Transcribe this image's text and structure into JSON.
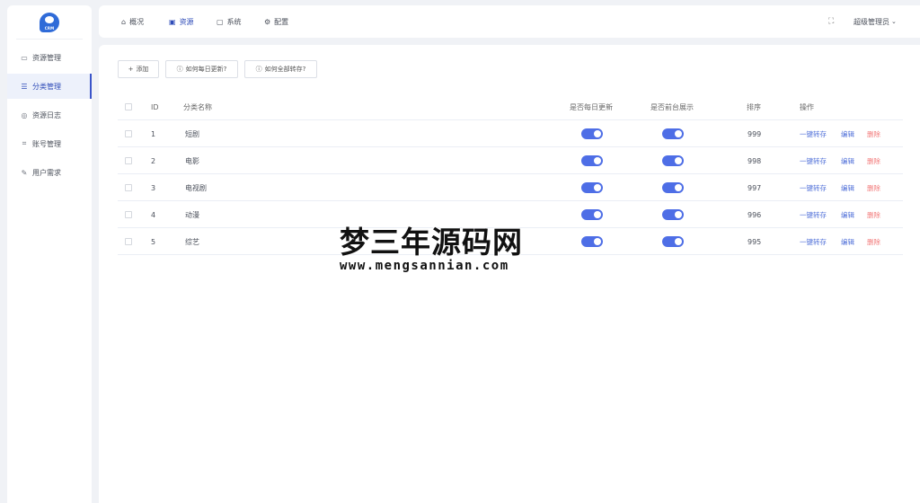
{
  "logo": {
    "text": "CRM"
  },
  "sidebar": {
    "items": [
      {
        "label": "资源管理",
        "icon": "folder-icon"
      },
      {
        "label": "分类管理",
        "icon": "sliders-icon",
        "active": true
      },
      {
        "label": "资源日志",
        "icon": "compass-icon"
      },
      {
        "label": "账号管理",
        "icon": "crop-icon"
      },
      {
        "label": "用户需求",
        "icon": "pen-icon"
      }
    ]
  },
  "topbar": {
    "tabs": [
      {
        "label": "概况",
        "icon": "home-icon"
      },
      {
        "label": "资源",
        "icon": "box-icon",
        "active": true
      },
      {
        "label": "系统",
        "icon": "monitor-icon"
      },
      {
        "label": "配置",
        "icon": "gear-icon"
      }
    ],
    "user": "超级管理员"
  },
  "toolbar": {
    "add_label": "添加",
    "daily_help_label": "如何每日更新?",
    "transfer_help_label": "如何全部转存?"
  },
  "table": {
    "headers": {
      "id": "ID",
      "name": "分类名称",
      "daily_update": "是否每日更新",
      "frontend_show": "是否前台展示",
      "sort": "排序",
      "actions": "操作"
    },
    "rows": [
      {
        "id": "1",
        "name": "短剧",
        "daily_update": true,
        "frontend_show": true,
        "sort": "999"
      },
      {
        "id": "2",
        "name": "电影",
        "daily_update": true,
        "frontend_show": true,
        "sort": "998"
      },
      {
        "id": "3",
        "name": "电视剧",
        "daily_update": true,
        "frontend_show": true,
        "sort": "997"
      },
      {
        "id": "4",
        "name": "动漫",
        "daily_update": true,
        "frontend_show": true,
        "sort": "996"
      },
      {
        "id": "5",
        "name": "综艺",
        "daily_update": true,
        "frontend_show": true,
        "sort": "995"
      }
    ],
    "actions": {
      "transfer": "一键转存",
      "edit": "编辑",
      "delete": "删除"
    }
  },
  "watermark": {
    "cn": "梦三年源码网",
    "en": "www.mengsannian.com"
  },
  "colors": {
    "accent": "#3b55c9",
    "switch_on": "#4e6ee6",
    "link": "#4f6fd8",
    "danger": "#f27a7a"
  }
}
